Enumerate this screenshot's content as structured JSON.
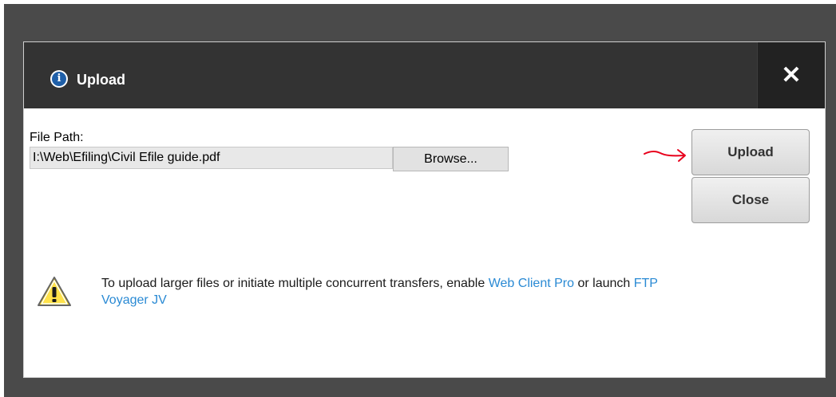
{
  "dialog": {
    "title": "Upload",
    "close_glyph": "✕"
  },
  "form": {
    "file_path_label": "File Path:",
    "file_path_value": "I:\\Web\\Efiling\\Civil Efile guide.pdf",
    "browse_label": "Browse..."
  },
  "buttons": {
    "upload_label": "Upload",
    "close_label": "Close"
  },
  "notice": {
    "text_before": "To upload larger files or initiate multiple concurrent transfers, enable ",
    "link_1": "Web Client Pro",
    "text_middle": " or launch ",
    "link_2": "FTP Voyager JV"
  },
  "icons": {
    "title_icon": "info-icon",
    "warning_icon": "warning-icon",
    "annotation": "red-arrow-annotation"
  },
  "colors": {
    "titlebar": "#333333",
    "link": "#2a8ad4",
    "info_blue": "#1f5fa8",
    "warning_yellow": "#ffd700",
    "annotation_red": "#e8001c"
  }
}
